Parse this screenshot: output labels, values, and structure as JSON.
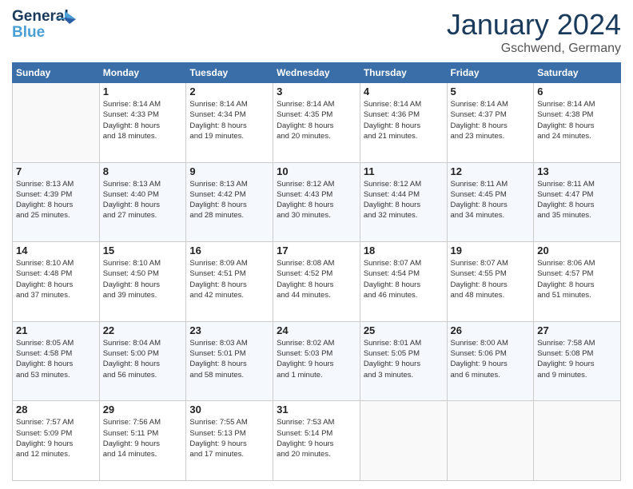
{
  "logo": {
    "line1": "General",
    "line2": "Blue"
  },
  "title": "January 2024",
  "location": "Gschwend, Germany",
  "days_of_week": [
    "Sunday",
    "Monday",
    "Tuesday",
    "Wednesday",
    "Thursday",
    "Friday",
    "Saturday"
  ],
  "weeks": [
    [
      {
        "num": "",
        "info": ""
      },
      {
        "num": "1",
        "info": "Sunrise: 8:14 AM\nSunset: 4:33 PM\nDaylight: 8 hours\nand 18 minutes."
      },
      {
        "num": "2",
        "info": "Sunrise: 8:14 AM\nSunset: 4:34 PM\nDaylight: 8 hours\nand 19 minutes."
      },
      {
        "num": "3",
        "info": "Sunrise: 8:14 AM\nSunset: 4:35 PM\nDaylight: 8 hours\nand 20 minutes."
      },
      {
        "num": "4",
        "info": "Sunrise: 8:14 AM\nSunset: 4:36 PM\nDaylight: 8 hours\nand 21 minutes."
      },
      {
        "num": "5",
        "info": "Sunrise: 8:14 AM\nSunset: 4:37 PM\nDaylight: 8 hours\nand 23 minutes."
      },
      {
        "num": "6",
        "info": "Sunrise: 8:14 AM\nSunset: 4:38 PM\nDaylight: 8 hours\nand 24 minutes."
      }
    ],
    [
      {
        "num": "7",
        "info": "Sunrise: 8:13 AM\nSunset: 4:39 PM\nDaylight: 8 hours\nand 25 minutes."
      },
      {
        "num": "8",
        "info": "Sunrise: 8:13 AM\nSunset: 4:40 PM\nDaylight: 8 hours\nand 27 minutes."
      },
      {
        "num": "9",
        "info": "Sunrise: 8:13 AM\nSunset: 4:42 PM\nDaylight: 8 hours\nand 28 minutes."
      },
      {
        "num": "10",
        "info": "Sunrise: 8:12 AM\nSunset: 4:43 PM\nDaylight: 8 hours\nand 30 minutes."
      },
      {
        "num": "11",
        "info": "Sunrise: 8:12 AM\nSunset: 4:44 PM\nDaylight: 8 hours\nand 32 minutes."
      },
      {
        "num": "12",
        "info": "Sunrise: 8:11 AM\nSunset: 4:45 PM\nDaylight: 8 hours\nand 34 minutes."
      },
      {
        "num": "13",
        "info": "Sunrise: 8:11 AM\nSunset: 4:47 PM\nDaylight: 8 hours\nand 35 minutes."
      }
    ],
    [
      {
        "num": "14",
        "info": "Sunrise: 8:10 AM\nSunset: 4:48 PM\nDaylight: 8 hours\nand 37 minutes."
      },
      {
        "num": "15",
        "info": "Sunrise: 8:10 AM\nSunset: 4:50 PM\nDaylight: 8 hours\nand 39 minutes."
      },
      {
        "num": "16",
        "info": "Sunrise: 8:09 AM\nSunset: 4:51 PM\nDaylight: 8 hours\nand 42 minutes."
      },
      {
        "num": "17",
        "info": "Sunrise: 8:08 AM\nSunset: 4:52 PM\nDaylight: 8 hours\nand 44 minutes."
      },
      {
        "num": "18",
        "info": "Sunrise: 8:07 AM\nSunset: 4:54 PM\nDaylight: 8 hours\nand 46 minutes."
      },
      {
        "num": "19",
        "info": "Sunrise: 8:07 AM\nSunset: 4:55 PM\nDaylight: 8 hours\nand 48 minutes."
      },
      {
        "num": "20",
        "info": "Sunrise: 8:06 AM\nSunset: 4:57 PM\nDaylight: 8 hours\nand 51 minutes."
      }
    ],
    [
      {
        "num": "21",
        "info": "Sunrise: 8:05 AM\nSunset: 4:58 PM\nDaylight: 8 hours\nand 53 minutes."
      },
      {
        "num": "22",
        "info": "Sunrise: 8:04 AM\nSunset: 5:00 PM\nDaylight: 8 hours\nand 56 minutes."
      },
      {
        "num": "23",
        "info": "Sunrise: 8:03 AM\nSunset: 5:01 PM\nDaylight: 8 hours\nand 58 minutes."
      },
      {
        "num": "24",
        "info": "Sunrise: 8:02 AM\nSunset: 5:03 PM\nDaylight: 9 hours\nand 1 minute."
      },
      {
        "num": "25",
        "info": "Sunrise: 8:01 AM\nSunset: 5:05 PM\nDaylight: 9 hours\nand 3 minutes."
      },
      {
        "num": "26",
        "info": "Sunrise: 8:00 AM\nSunset: 5:06 PM\nDaylight: 9 hours\nand 6 minutes."
      },
      {
        "num": "27",
        "info": "Sunrise: 7:58 AM\nSunset: 5:08 PM\nDaylight: 9 hours\nand 9 minutes."
      }
    ],
    [
      {
        "num": "28",
        "info": "Sunrise: 7:57 AM\nSunset: 5:09 PM\nDaylight: 9 hours\nand 12 minutes."
      },
      {
        "num": "29",
        "info": "Sunrise: 7:56 AM\nSunset: 5:11 PM\nDaylight: 9 hours\nand 14 minutes."
      },
      {
        "num": "30",
        "info": "Sunrise: 7:55 AM\nSunset: 5:13 PM\nDaylight: 9 hours\nand 17 minutes."
      },
      {
        "num": "31",
        "info": "Sunrise: 7:53 AM\nSunset: 5:14 PM\nDaylight: 9 hours\nand 20 minutes."
      },
      {
        "num": "",
        "info": ""
      },
      {
        "num": "",
        "info": ""
      },
      {
        "num": "",
        "info": ""
      }
    ]
  ]
}
